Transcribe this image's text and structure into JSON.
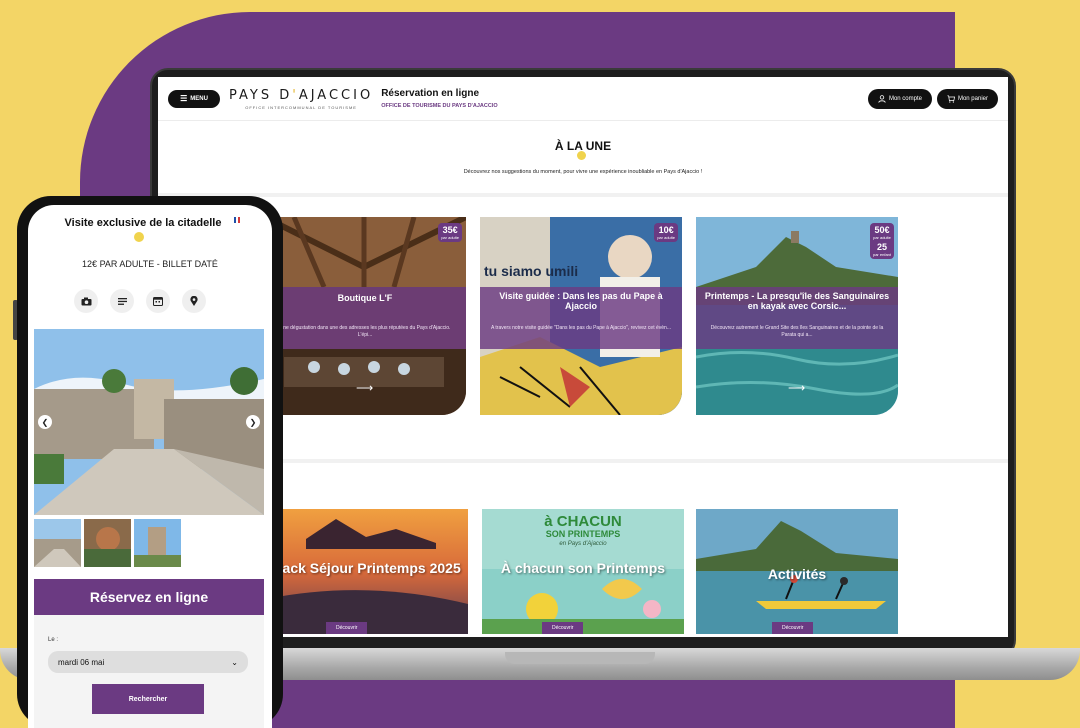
{
  "laptop": {
    "header": {
      "menu_label": "MENU",
      "logo_pre": "PAYS D",
      "logo_accent": "'",
      "logo_post": "AJACCIO",
      "logo_sub": "OFFICE INTERCOMMUNAL DE TOURISME",
      "resa_title": "Réservation en ligne",
      "resa_sub": "OFFICE DE TOURISME DU PAYS D'AJACCIO",
      "account": "Mon compte",
      "cart": "Mon panier"
    },
    "section": {
      "title": "À LA UNE",
      "subtitle": "Découvrez nos suggestions du moment, pour vivre une expérience inoubliable en Pays d'Ajaccio !"
    },
    "cards": [
      {
        "title": "Boutique L'F",
        "desc": "Une dégustation dans une des adresses les plus réputées du Pays d'Ajaccio. L'épi...",
        "price": "35€",
        "unit": "par adulte"
      },
      {
        "title": "Visite guidée : Dans les pas du Pape à Ajaccio",
        "desc": "A travers notre visite guidée \"Dans les pas du Pape à Ajaccio\", revivez cet évèn...",
        "price": "10€",
        "unit": "par adulte",
        "mural_text": "tu siamo umili"
      },
      {
        "title": "Printemps - La presqu'île des Sanguinaires en kayak avec Corsic...",
        "desc": "Découvrez autrement le Grand Site des îles Sanguinaires et de la pointe de la Parata qui a...",
        "price": "50€",
        "unit": "par adulte",
        "price2": "25",
        "unit2": "par enfant"
      }
    ],
    "bottom_cards": [
      {
        "title": "Pack Séjour Printemps 2025",
        "button": "Découvrir"
      },
      {
        "title": "À chacun son Printemps",
        "button": "Découvrir",
        "poster_line1": "à CHACUN",
        "poster_line2": "SON PRINTEMPS",
        "poster_line3": "en Pays d'Ajaccio"
      },
      {
        "title": "Activités",
        "button": "Découvrir"
      }
    ]
  },
  "phone": {
    "title": "Visite exclusive de la citadelle",
    "price": "12€ PAR ADULTE - BILLET DATÉ",
    "book_title": "Réservez en ligne",
    "date_label": "Le :",
    "date_value": "mardi 06 mai",
    "search_button": "Rechercher"
  },
  "colors": {
    "brand_purple": "#6b3a82",
    "accent_yellow": "#f0d34d",
    "background_yellow": "#f3d566"
  },
  "icons": [
    "camera-icon",
    "description-icon",
    "calendar-icon",
    "location-pin-icon",
    "user-icon",
    "cart-icon",
    "menu-icon",
    "arrow-right-icon",
    "arrow-left-icon",
    "chevron-down-icon"
  ]
}
